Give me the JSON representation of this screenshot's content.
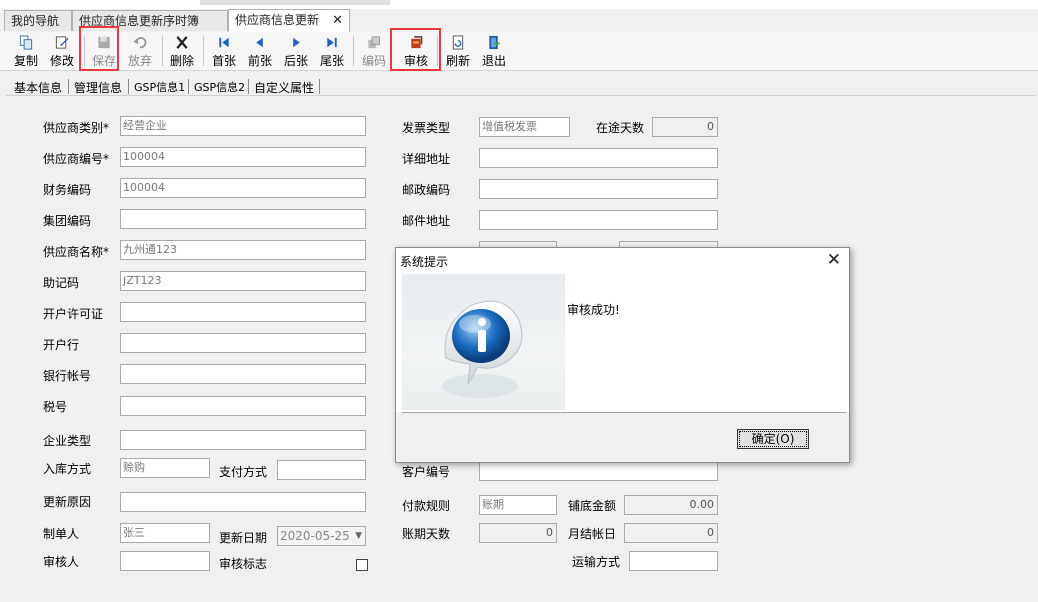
{
  "tabs": [
    {
      "label": "我的导航"
    },
    {
      "label": "供应商信息更新序时簿"
    },
    {
      "label": "供应商信息更新"
    }
  ],
  "tab_close": "✕",
  "toolbar": {
    "copy": "复制",
    "edit": "修改",
    "save": "保存",
    "discard": "放弃",
    "delete": "删除",
    "first": "首张",
    "prev": "前张",
    "next": "后张",
    "last": "尾张",
    "encode": "编码",
    "audit": "审核",
    "refresh": "刷新",
    "exit": "退出"
  },
  "subtabs": [
    "基本信息",
    "管理信息",
    "GSP信息1",
    "GSP信息2",
    "自定义属性"
  ],
  "form": {
    "supplier_type_label": "供应商类别*",
    "supplier_type": "经营企业",
    "supplier_code_label": "供应商编号*",
    "supplier_code": "100004",
    "finance_code_label": "财务编码",
    "finance_code": "100004",
    "group_code_label": "集团编码",
    "group_code": "",
    "supplier_name_label": "供应商名称*",
    "supplier_name": "九州通123",
    "mnemonic_label": "助记码",
    "mnemonic": "JZT123",
    "license_label": "开户许可证",
    "license": "",
    "bank_label": "开户行",
    "bank": "",
    "bank_account_label": "银行帐号",
    "bank_account": "",
    "tax_no_label": "税号",
    "tax_no": "",
    "enterprise_type_label": "企业类型",
    "enterprise_type": "",
    "stock_in_label": "入库方式",
    "stock_in": "赊购",
    "pay_method_label": "支付方式",
    "pay_method": "",
    "update_reason_label": "更新原因",
    "update_reason": "",
    "creator_label": "制单人",
    "creator": "张三",
    "update_date_label": "更新日期",
    "update_date": "2020-05-25",
    "auditor_label": "审核人",
    "auditor": "",
    "audit_flag_label": "审核标志",
    "invoice_type_label": "发票类型",
    "invoice_type": "增值税发票",
    "transit_days_label": "在途天数",
    "transit_days": "0",
    "address_label": "详细地址",
    "address": "",
    "postcode_label": "邮政编码",
    "postcode": "",
    "mail_address_label": "邮件地址",
    "mail_address": "",
    "customer_no_label": "客户编号",
    "customer_no": "",
    "payment_rule_label": "付款规则",
    "payment_rule": "账期",
    "base_amount_label": "铺底金额",
    "base_amount": "0.00",
    "credit_days_label": "账期天数",
    "credit_days": "0",
    "month_close_label": "月结帐日",
    "month_close": "0",
    "transport_label": "运输方式",
    "transport": ""
  },
  "dialog": {
    "title": "系统提示",
    "close": "✕",
    "message": "审核成功!",
    "ok_label": "确定(O)"
  }
}
